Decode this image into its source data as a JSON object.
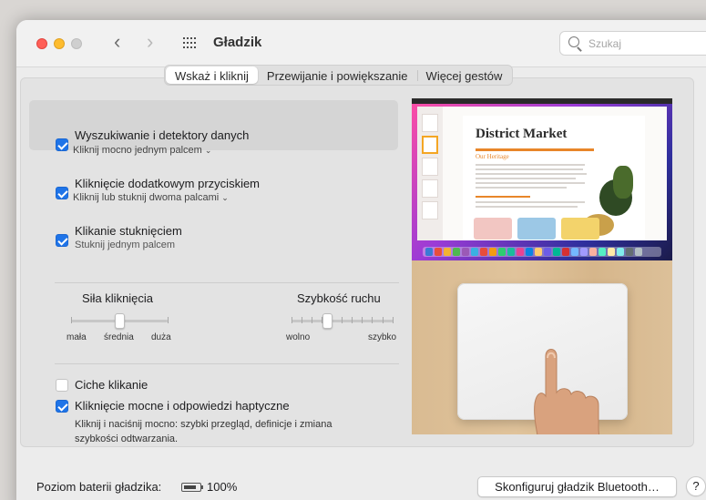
{
  "window": {
    "title": "Gładzik",
    "search_placeholder": "Szukaj"
  },
  "tabs": [
    {
      "label": "Wskaż i kliknij",
      "active": true
    },
    {
      "label": "Przewijanie i powiększanie",
      "active": false
    },
    {
      "label": "Więcej gestów",
      "active": false
    }
  ],
  "options": [
    {
      "title": "Wyszukiwanie i detektory danych",
      "subtitle": "Kliknij mocno jednym palcem",
      "checked": true,
      "has_dropdown": true
    },
    {
      "title": "Kliknięcie dodatkowym przyciskiem",
      "subtitle": "Kliknij lub stuknij dwoma palcami",
      "checked": true,
      "has_dropdown": true
    },
    {
      "title": "Klikanie stuknięciem",
      "subtitle": "Stuknij jednym palcem",
      "checked": true,
      "has_dropdown": false
    }
  ],
  "sliders": {
    "click_force": {
      "label": "Siła kliknięcia",
      "min_label": "mała",
      "mid_label": "średnia",
      "max_label": "duża",
      "value_fraction": 0.5
    },
    "tracking_speed": {
      "label": "Szybkość ruchu",
      "min_label": "wolno",
      "max_label": "szybko",
      "value_fraction": 0.33
    }
  },
  "bottom_options": [
    {
      "title": "Ciche klikanie",
      "checked": false
    },
    {
      "title": "Kliknięcie mocne i odpowiedzi haptyczne",
      "checked": true,
      "description_line1": "Kliknij i naciśnij mocno: szybki przegląd, definicje i zmiana",
      "description_line2": "szybkości odtwarzania."
    }
  ],
  "preview": {
    "doc_title": "District Market",
    "doc_heading": "Our Heritage"
  },
  "footer": {
    "battery_label": "Poziom baterii gładzika:",
    "battery_percent": "100%",
    "bluetooth_button": "Skonfiguruj gładzik Bluetooth…",
    "help_button": "?"
  },
  "colors": {
    "accent": "#1f74e8",
    "close": "#ff5f57",
    "minimize": "#febc2e"
  }
}
